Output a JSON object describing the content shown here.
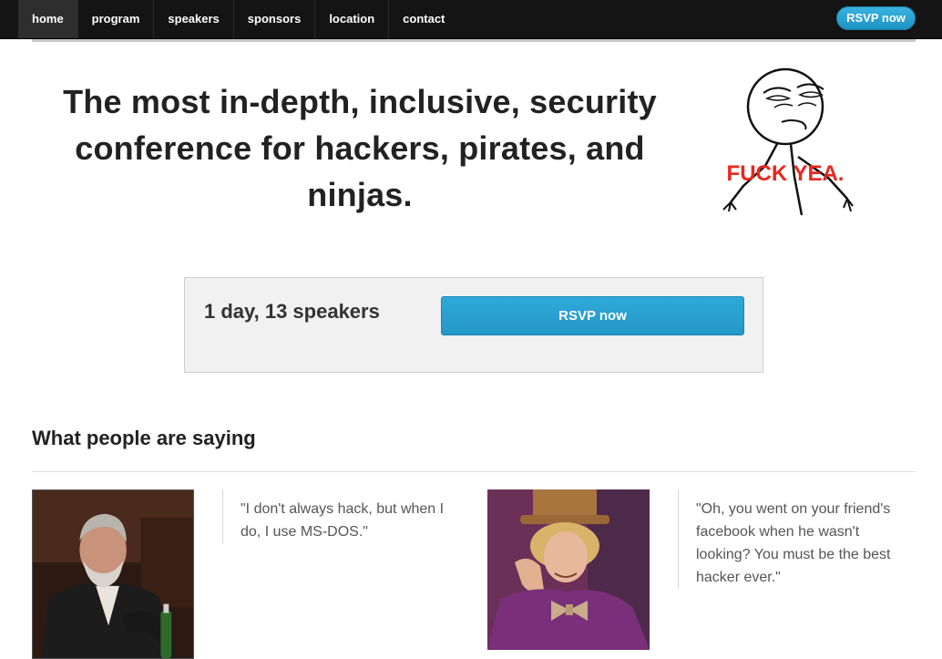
{
  "nav": {
    "items": [
      {
        "label": "home",
        "active": true
      },
      {
        "label": "program"
      },
      {
        "label": "speakers"
      },
      {
        "label": "sponsors"
      },
      {
        "label": "location"
      },
      {
        "label": "contact"
      }
    ],
    "rsvp_label": "RSVP now"
  },
  "hero": {
    "title": "The most in-depth, inclusive, security conference for hackers, pirates, and ninjas.",
    "meme_caption": "FUCK YEA."
  },
  "callout": {
    "text": "1 day, 13 speakers",
    "button_label": "RSVP now"
  },
  "testimonials": {
    "heading": "What people are saying",
    "items": [
      {
        "quote": "\"I don't always hack, but when I do, I use MS-DOS.\""
      },
      {
        "quote": "\"Oh, you went on your friend's facebook when he wasn't looking? You must be the best hacker ever.\""
      }
    ]
  },
  "colors": {
    "navbar": "#141414",
    "accent": "#2aa3d3",
    "meme_caption": "#e8281e"
  }
}
